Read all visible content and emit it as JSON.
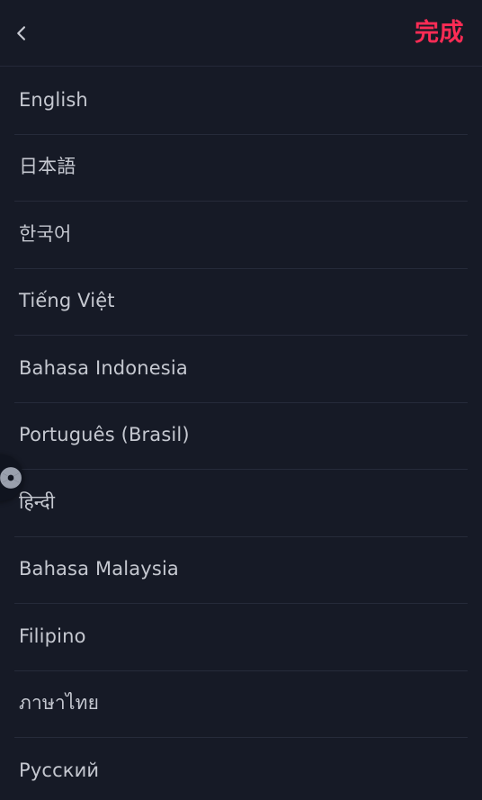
{
  "header": {
    "back_icon": "chevron-left-icon",
    "done_label": "完成",
    "accent_color": "#fe2c55"
  },
  "colors": {
    "background": "#161a26",
    "divider": "#262b3a",
    "text": "#c5c8d0",
    "icon": "#c8cad2",
    "accent": "#fe2c55"
  },
  "language_list": {
    "items": [
      {
        "label": "English"
      },
      {
        "label": "日本語"
      },
      {
        "label": "한국어"
      },
      {
        "label": "Tiếng Việt"
      },
      {
        "label": "Bahasa Indonesia"
      },
      {
        "label": "Português (Brasil)"
      },
      {
        "label": "हिन्दी"
      },
      {
        "label": "Bahasa Malaysia"
      },
      {
        "label": "Filipino"
      },
      {
        "label": "ภาษาไทย"
      },
      {
        "label": "Русский"
      }
    ]
  },
  "floating_widget": {
    "icon": "aperture-icon"
  }
}
